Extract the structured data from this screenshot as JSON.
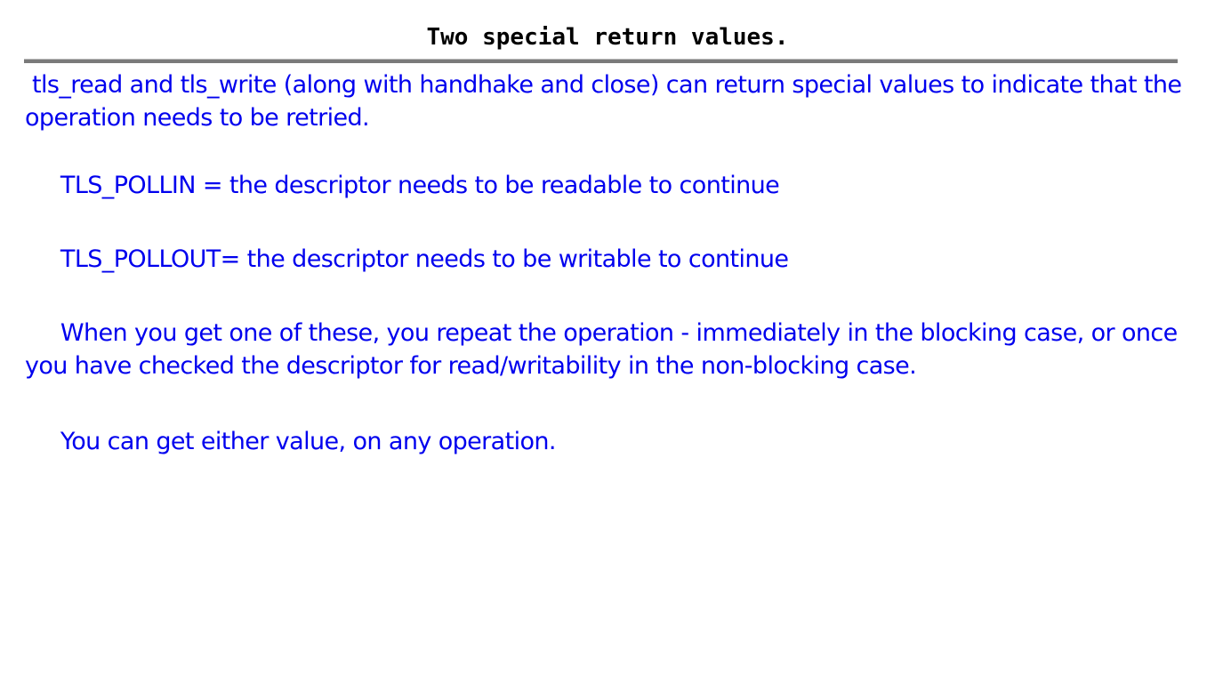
{
  "slide": {
    "title": "Two special return values.",
    "paragraphs": [
      " tls_read and tls_write (along with handhake and close) can return special values to indicate that the operation needs to be retried.",
      "     TLS_POLLIN = the descriptor needs to be readable to continue",
      "     TLS_POLLOUT= the descriptor needs to be writable to continue",
      "     When you get one of these, you repeat the operation - immediately in the blocking case, or once you have checked the descriptor for read/writability in the non-blocking case.",
      "     You can get either value, on any operation."
    ]
  },
  "colors": {
    "title": "#000000",
    "body_text": "#0000ee",
    "rule": "#7a7a7a",
    "background": "#ffffff"
  }
}
